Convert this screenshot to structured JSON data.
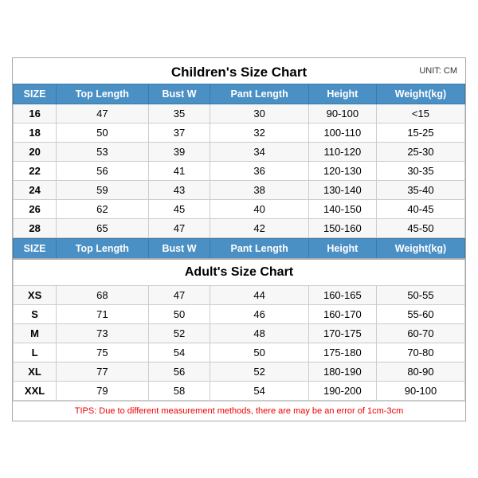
{
  "mainTitle": "Children's Size Chart",
  "unitLabel": "UNIT: CM",
  "childrenHeaders": [
    "SIZE",
    "Top Length",
    "Bust W",
    "Pant Length",
    "Height",
    "Weight(kg)"
  ],
  "childrenRows": [
    [
      "16",
      "47",
      "35",
      "30",
      "90-100",
      "<15"
    ],
    [
      "18",
      "50",
      "37",
      "32",
      "100-110",
      "15-25"
    ],
    [
      "20",
      "53",
      "39",
      "34",
      "110-120",
      "25-30"
    ],
    [
      "22",
      "56",
      "41",
      "36",
      "120-130",
      "30-35"
    ],
    [
      "24",
      "59",
      "43",
      "38",
      "130-140",
      "35-40"
    ],
    [
      "26",
      "62",
      "45",
      "40",
      "140-150",
      "40-45"
    ],
    [
      "28",
      "65",
      "47",
      "42",
      "150-160",
      "45-50"
    ]
  ],
  "adultsTitle": "Adult's Size Chart",
  "adultsHeaders": [
    "SIZE",
    "Top Length",
    "Bust W",
    "Pant Length",
    "Height",
    "Weight(kg)"
  ],
  "adultsRows": [
    [
      "XS",
      "68",
      "47",
      "44",
      "160-165",
      "50-55"
    ],
    [
      "S",
      "71",
      "50",
      "46",
      "160-170",
      "55-60"
    ],
    [
      "M",
      "73",
      "52",
      "48",
      "170-175",
      "60-70"
    ],
    [
      "L",
      "75",
      "54",
      "50",
      "175-180",
      "70-80"
    ],
    [
      "XL",
      "77",
      "56",
      "52",
      "180-190",
      "80-90"
    ],
    [
      "XXL",
      "79",
      "58",
      "54",
      "190-200",
      "90-100"
    ]
  ],
  "tipsText": "TIPS: Due to different measurement methods, there are may be an error of 1cm-3cm"
}
